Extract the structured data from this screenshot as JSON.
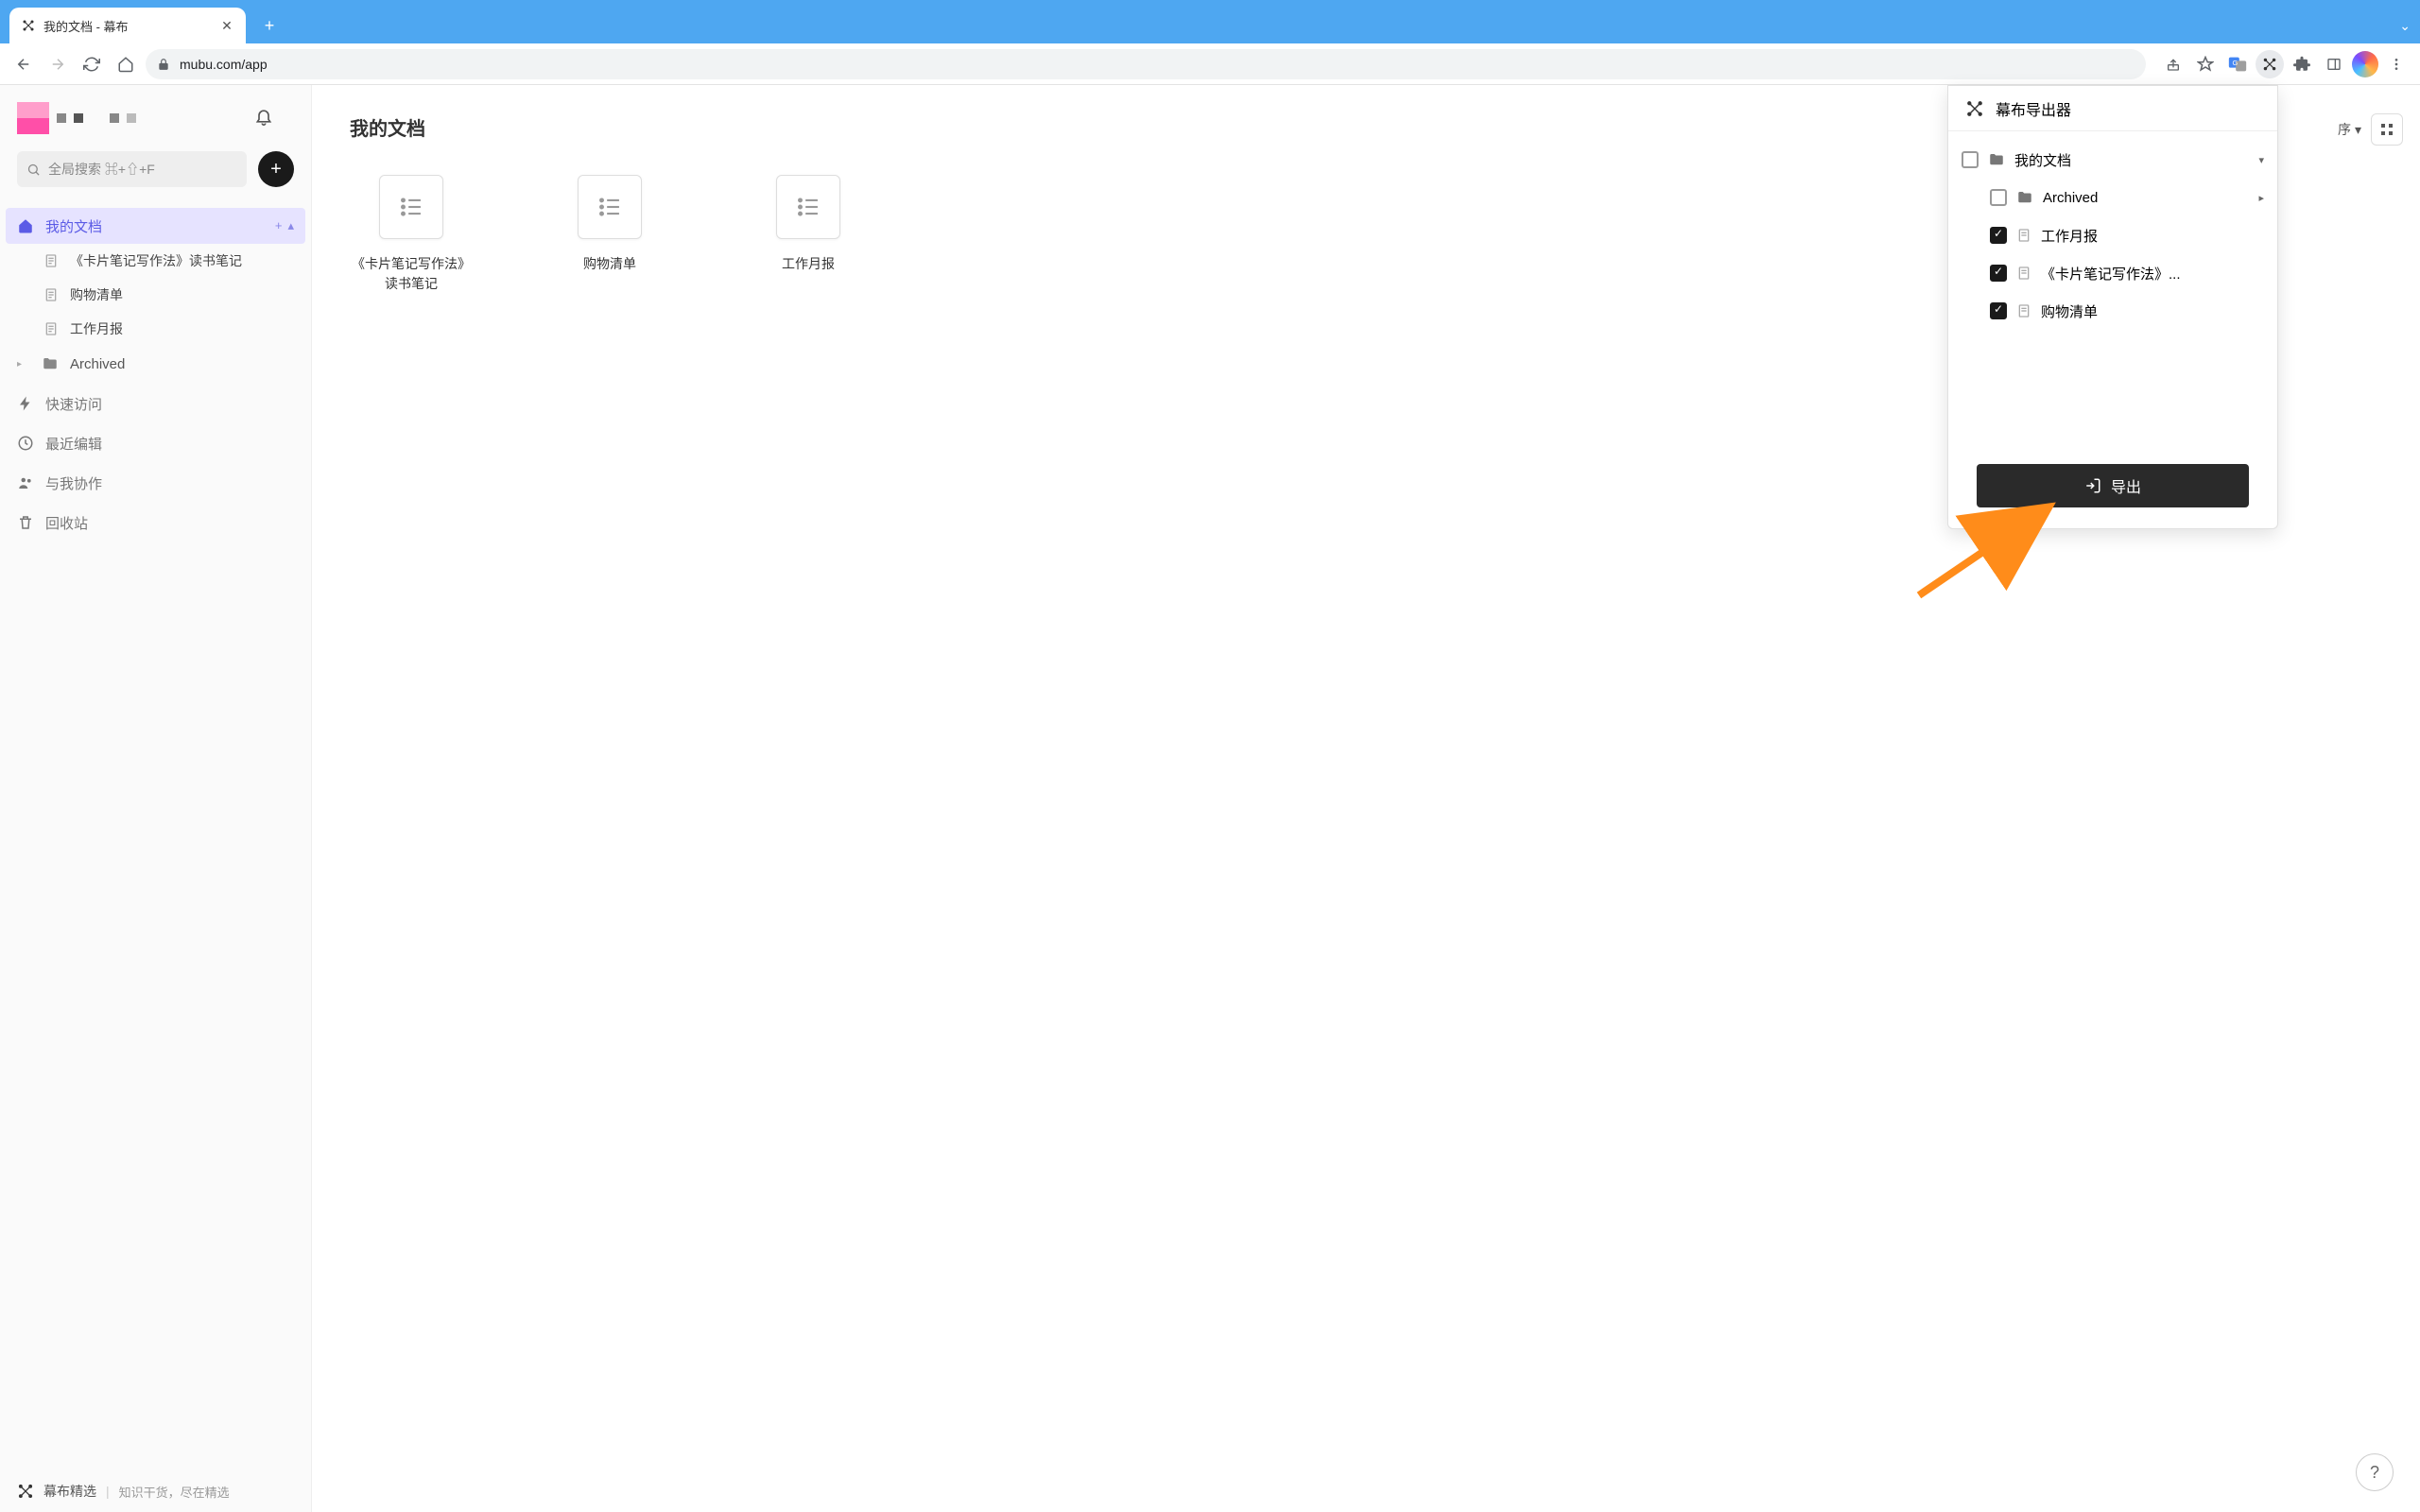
{
  "browser": {
    "tab_title": "我的文档 - 幕布",
    "url": "mubu.com/app"
  },
  "sidebar": {
    "search_placeholder": "全局搜索 ⌘+⇧+F",
    "nav": {
      "my_docs": "我的文档",
      "docs": [
        "《卡片笔记写作法》读书笔记",
        "购物清单",
        "工作月报"
      ],
      "archived": "Archived",
      "quick_access": "快速访问",
      "recent": "最近编辑",
      "shared": "与我协作",
      "trash": "回收站"
    },
    "footer": {
      "main": "幕布精选",
      "sub": "知识干货，尽在精选"
    }
  },
  "main": {
    "title": "我的文档",
    "sort_label": "序",
    "docs": [
      {
        "name": "《卡片笔记写作法》读书笔记"
      },
      {
        "name": "购物清单"
      },
      {
        "name": "工作月报"
      }
    ]
  },
  "ext": {
    "title": "幕布导出器",
    "tree": {
      "root": "我的文档",
      "archived": "Archived",
      "items": [
        "工作月报",
        "《卡片笔记写作法》...",
        "购物清单"
      ]
    },
    "export_label": "导出"
  }
}
